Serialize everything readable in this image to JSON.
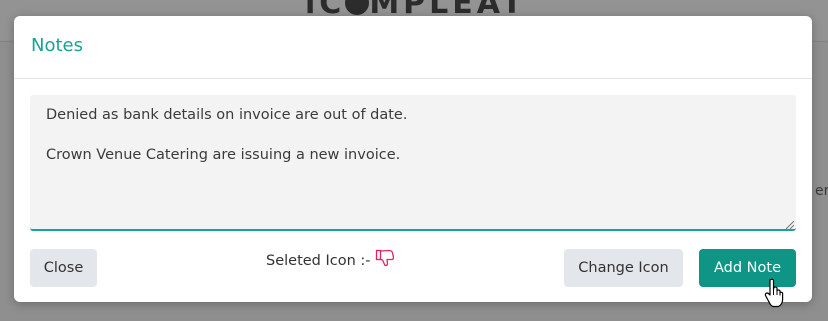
{
  "background": {
    "logo_text": "iC MPLEAT",
    "fragment": "er"
  },
  "modal": {
    "title": "Notes",
    "notes_value": "Denied as bank details on invoice are out of date.\n\nCrown Venue Catering are issuing a new invoice.",
    "selected_icon_label": "Seleted Icon :-",
    "selected_icon": "thumbs-down-icon",
    "close_label": "Close",
    "change_icon_label": "Change Icon",
    "add_note_label": "Add Note"
  },
  "colors": {
    "accent": "#1aa294",
    "primary_button": "#0e9585",
    "secondary_button": "#e3e6ea",
    "icon_pink": "#e0245e"
  }
}
